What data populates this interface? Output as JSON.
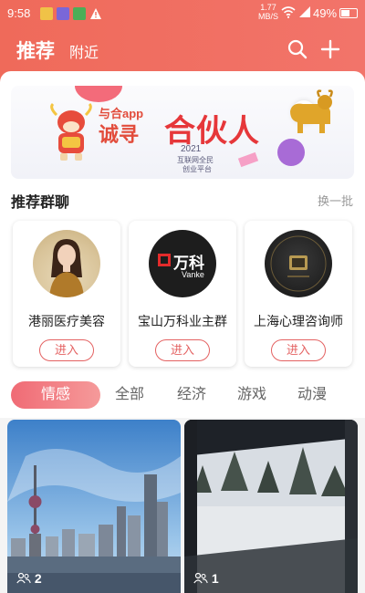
{
  "status_bar": {
    "time": "9:58",
    "net_speed_value": "1.77",
    "net_speed_unit": "MB/S",
    "battery": "49%"
  },
  "header": {
    "tab_recommend": "推荐",
    "tab_nearby": "附近",
    "icons": [
      "search-icon",
      "plus-icon"
    ]
  },
  "banner": {
    "app_name": "与合app",
    "slogan_part1": "诚寻",
    "slogan_part2": "合伙人",
    "year": "2021",
    "subline1": "互联网全民",
    "subline2": "创业平台"
  },
  "groups_section": {
    "title": "推荐群聊",
    "refresh": "换一批",
    "groups": [
      {
        "name": "港丽医疗美容",
        "join": "进入"
      },
      {
        "name": "宝山万科业主群",
        "join": "进入"
      },
      {
        "name": "上海心理咨询师",
        "join": "进入"
      }
    ],
    "logo_text_cn": "万科",
    "logo_text_en": "Vanke"
  },
  "categories": {
    "items": [
      "情感",
      "全部",
      "经济",
      "游戏",
      "动漫"
    ],
    "active": "情感"
  },
  "tiles": [
    {
      "count": "2"
    },
    {
      "count": "1"
    }
  ],
  "colors": {
    "header": "#ef6a5a",
    "accent": "#e46262"
  }
}
